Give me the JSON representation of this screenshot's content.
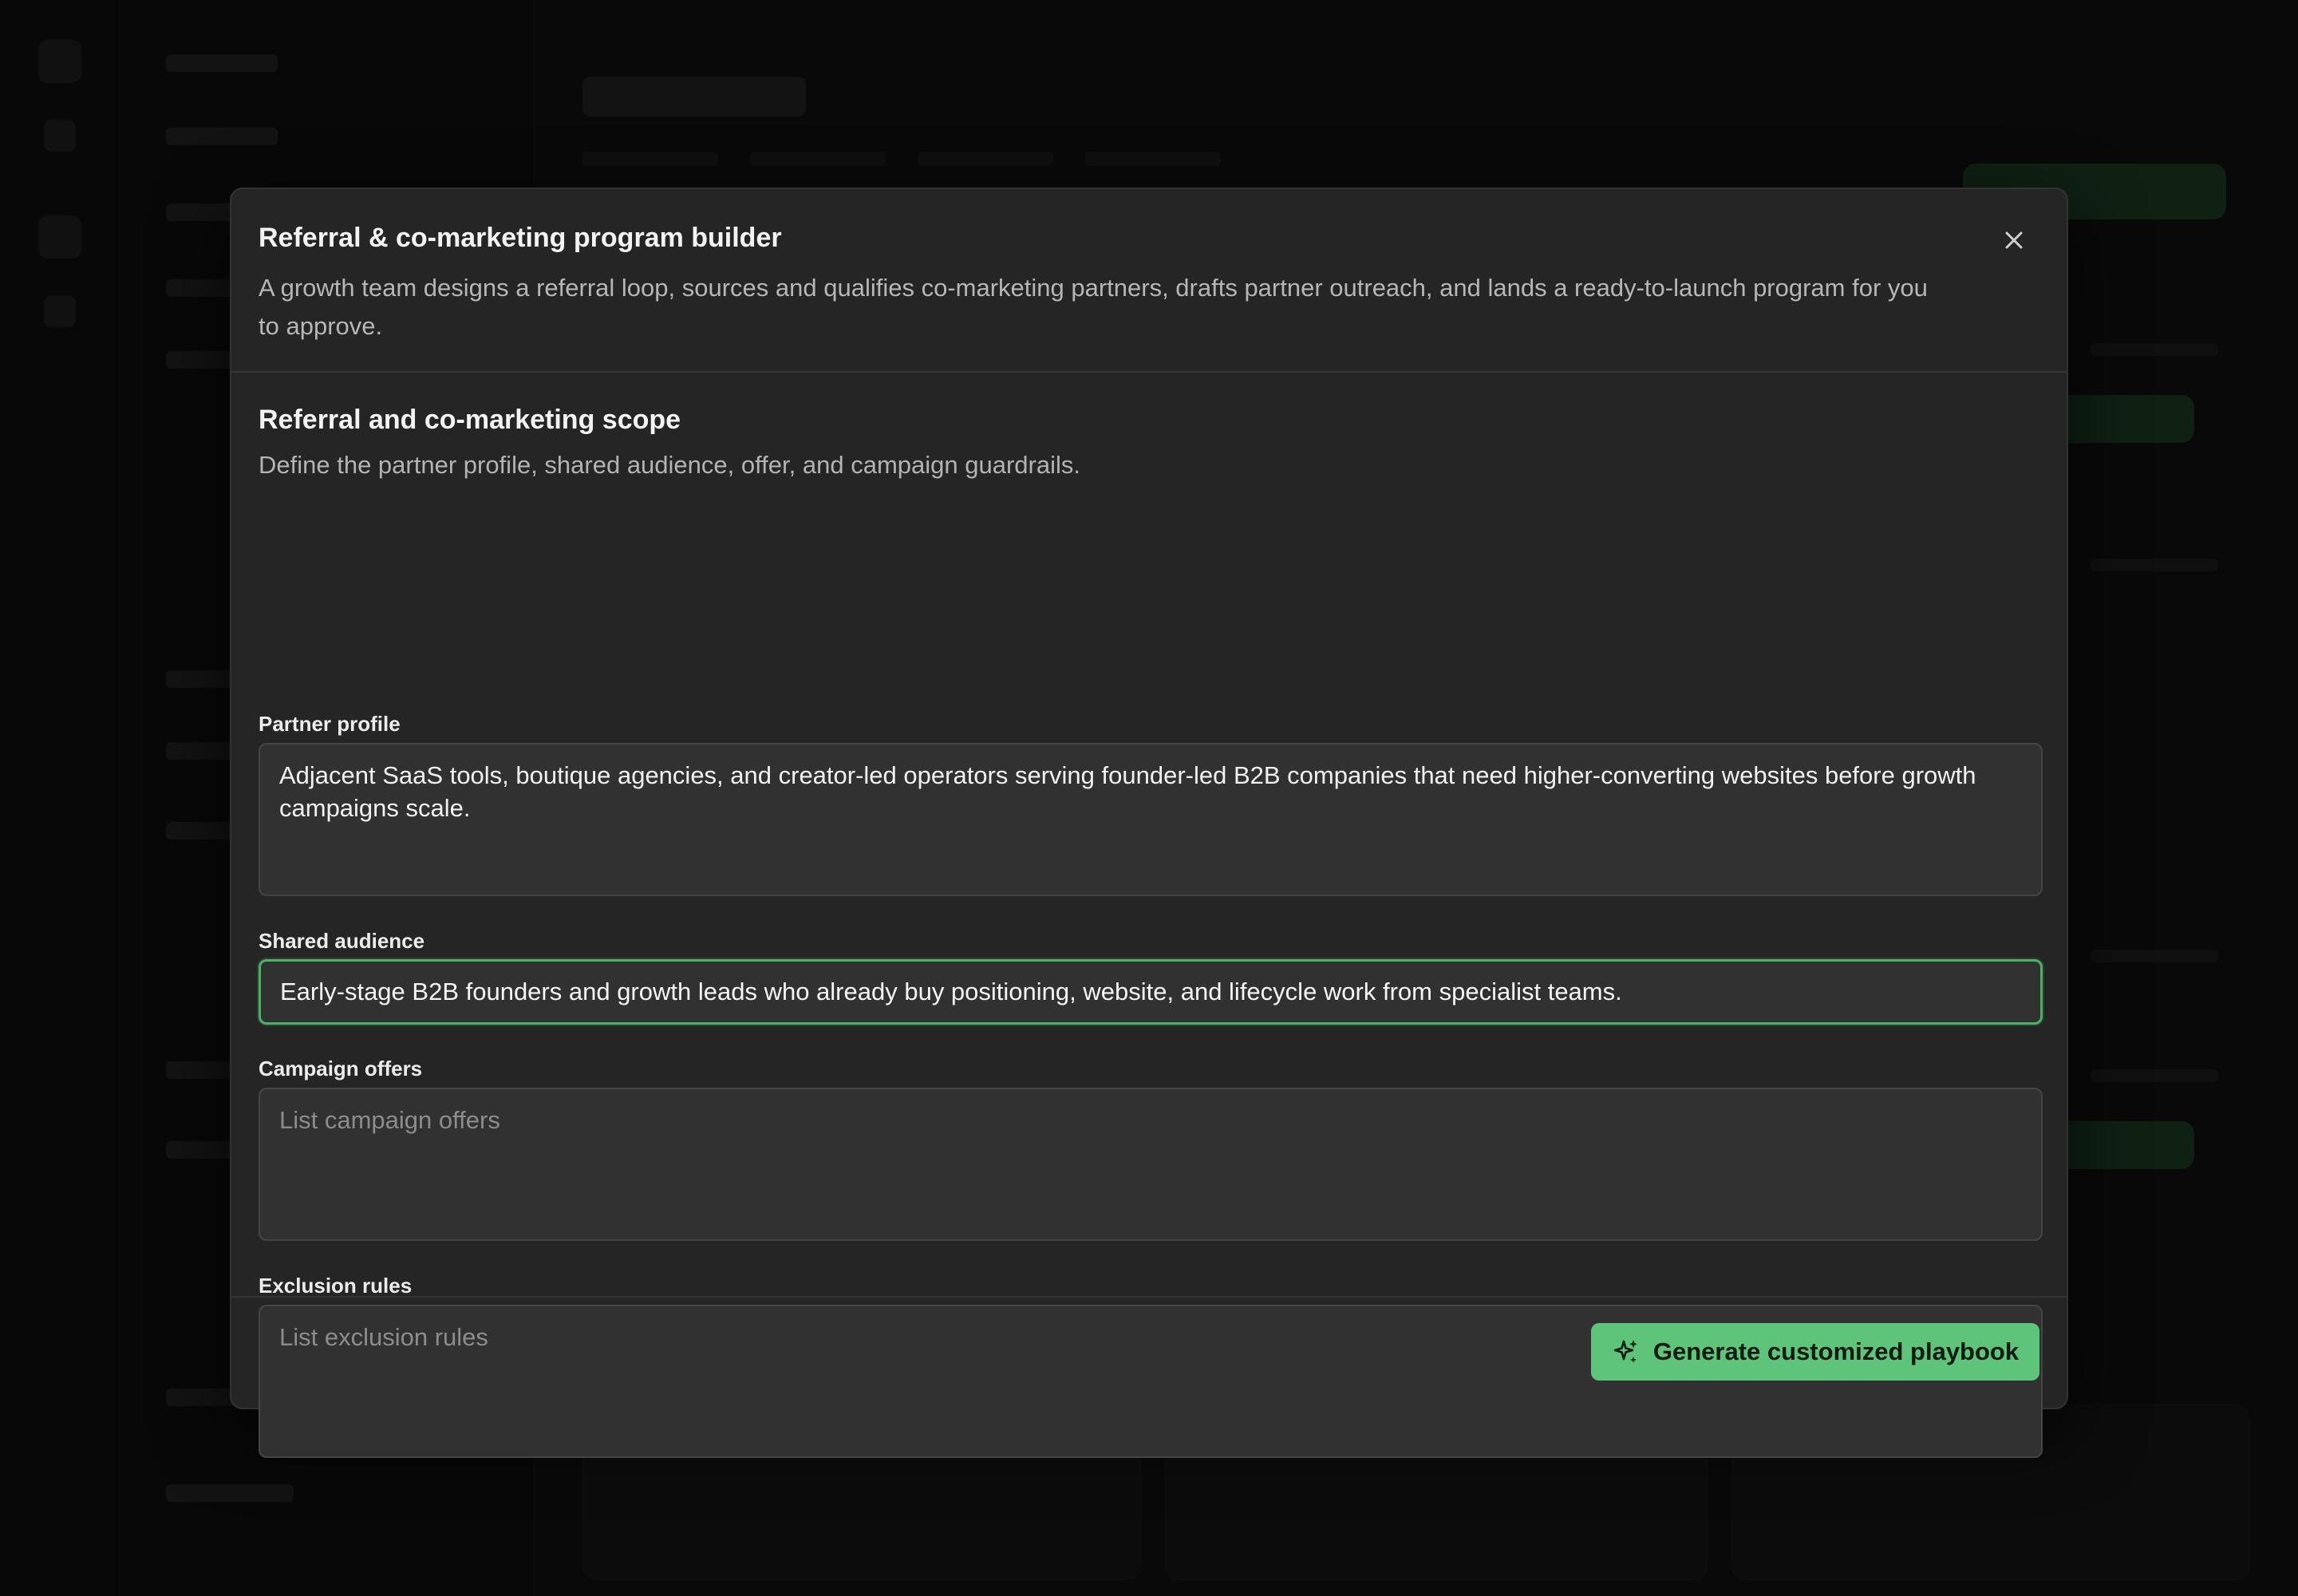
{
  "modal": {
    "title": "Referral & co-marketing program builder",
    "description": "A growth team designs a referral loop, sources and qualifies co-marketing partners, drafts partner outreach, and lands a ready-to-launch program for you to approve.",
    "close_icon": "close-icon"
  },
  "section": {
    "title": "Referral and co-marketing scope",
    "description": "Define the partner profile, shared audience, offer, and campaign guardrails."
  },
  "fields": {
    "partner_profile": {
      "label": "Partner profile",
      "value": "Adjacent SaaS tools, boutique agencies, and creator-led operators serving founder-led B2B companies that need higher-converting websites before growth campaigns scale."
    },
    "shared_audience": {
      "label": "Shared audience",
      "value": "Early-stage B2B founders and growth leads who already buy positioning, website, and lifecycle work from specialist teams."
    },
    "campaign_offers": {
      "label": "Campaign offers",
      "placeholder": "List campaign offers"
    },
    "exclusion_rules": {
      "label": "Exclusion rules",
      "placeholder": "List exclusion rules"
    }
  },
  "footer": {
    "primary_label": "Generate customized playbook",
    "primary_icon": "sparkle-icon"
  },
  "colors": {
    "accent": "#5ec47a",
    "focus_border": "#48b265",
    "modal_bg": "#252525",
    "field_bg": "#313131"
  }
}
